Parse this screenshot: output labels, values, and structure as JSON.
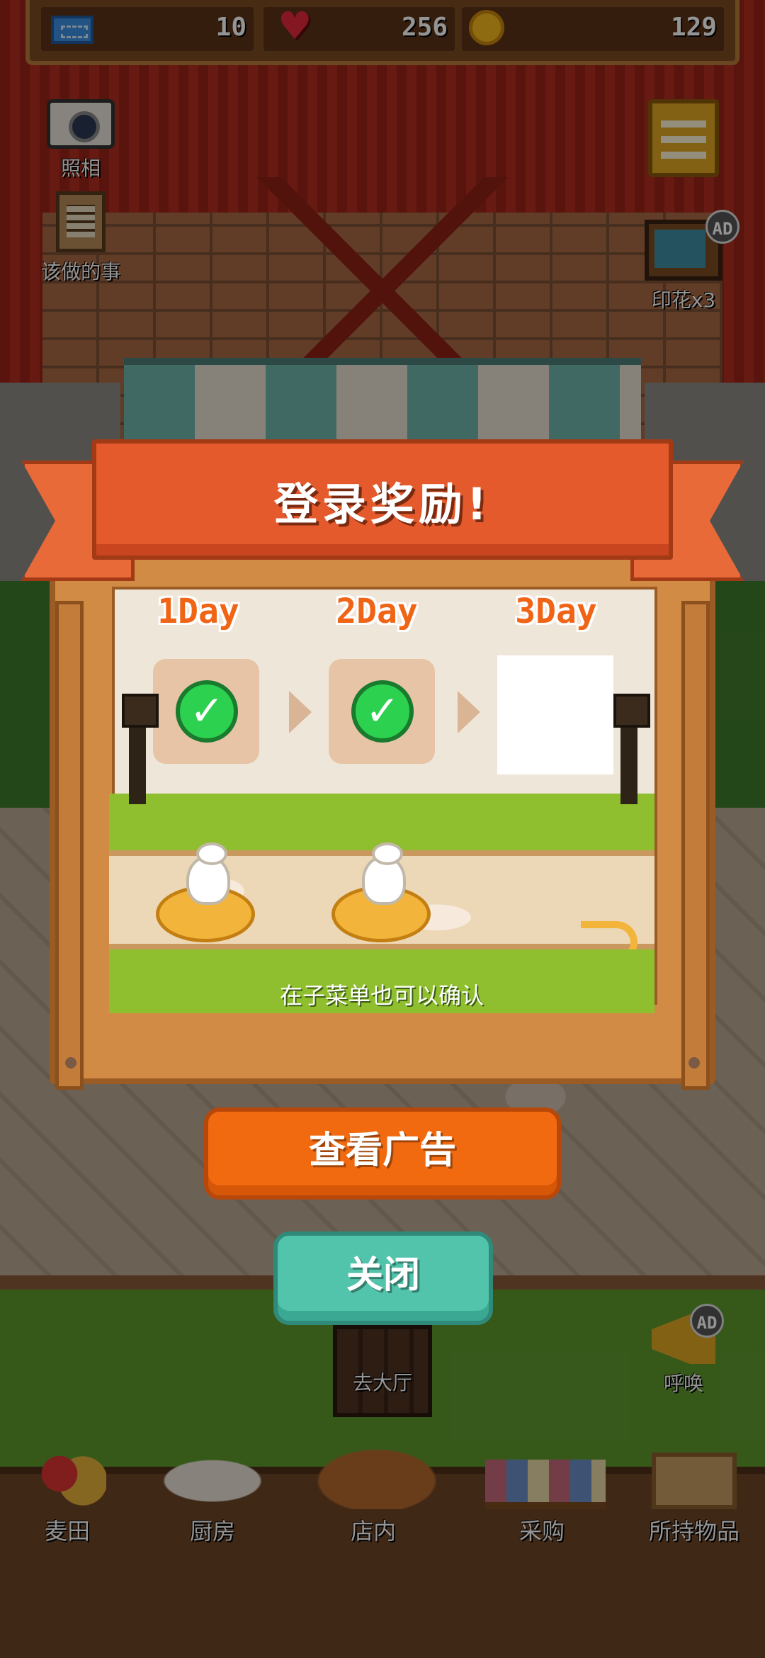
{
  "resources": {
    "tickets": "10",
    "hearts": "256",
    "coins": "129"
  },
  "side_buttons": {
    "camera": "照相",
    "todo": "该做的事",
    "stamps": "印花x3",
    "call": "呼唤",
    "hall": "去大厅",
    "ad_badge": "AD"
  },
  "dialog": {
    "title": "登录奖励!",
    "days": [
      "1Day",
      "2Day",
      "3Day"
    ],
    "claimed": [
      true,
      true,
      false
    ],
    "hint": "在子菜单也可以确认",
    "ad_button": "查看广告",
    "close_button": "关闭"
  },
  "bottom_nav": [
    "麦田",
    "厨房",
    "店内",
    "采购",
    "所持物品"
  ],
  "colors": {
    "accent_orange": "#f26a10",
    "close_teal": "#52c4ac",
    "day_label": "#f06416",
    "check_green": "#2bd14f"
  }
}
